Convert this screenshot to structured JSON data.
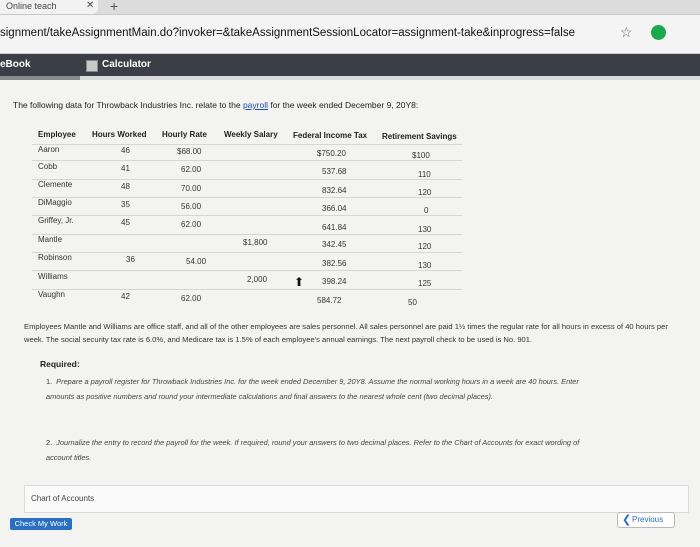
{
  "browser": {
    "tab_title": "Online teach",
    "close_glyph": "✕",
    "newtab_glyph": "+",
    "url": "signment/takeAssignmentMain.do?invoker=&takeAssignmentSessionLocator=assignment-take&inprogress=false",
    "star_glyph": "☆",
    "extension_glyph": "●"
  },
  "toolbar": {
    "ebook_label": "eBook",
    "calculator_label": "Calculator"
  },
  "problem": {
    "intro_before": "The following data for Throwback Industries Inc. relate to the ",
    "intro_link": "payroll",
    "intro_after": " for the week ended December 9, 20Y8:",
    "columns": [
      "Employee",
      "Hours Worked",
      "Hourly Rate",
      "Weekly Salary",
      "Federal Income Tax",
      "Retirement Savings"
    ],
    "rows": [
      {
        "employee": "Aaron",
        "hours": "46",
        "rate": "$68.00",
        "salary": "",
        "fit": "$750.20",
        "retire": "$100"
      },
      {
        "employee": "Cobb",
        "hours": "41",
        "rate": "62.00",
        "salary": "",
        "fit": "537.68",
        "retire": "110"
      },
      {
        "employee": "Clemente",
        "hours": "48",
        "rate": "70.00",
        "salary": "",
        "fit": "832.64",
        "retire": "120"
      },
      {
        "employee": "DiMaggio",
        "hours": "35",
        "rate": "56.00",
        "salary": "",
        "fit": "366.04",
        "retire": "0"
      },
      {
        "employee": "Griffey, Jr.",
        "hours": "45",
        "rate": "62.00",
        "salary": "",
        "fit": "641.84",
        "retire": "130"
      },
      {
        "employee": "Mantle",
        "hours": "",
        "rate": "",
        "salary": "$1,800",
        "fit": "342.45",
        "retire": "120"
      },
      {
        "employee": "Robinson",
        "hours": "36",
        "rate": "54.00",
        "salary": "",
        "fit": "382.56",
        "retire": "130"
      },
      {
        "employee": "Williams",
        "hours": "",
        "rate": "",
        "salary": "2,000",
        "fit": "398.24",
        "retire": "125"
      },
      {
        "employee": "Vaughn",
        "hours": "42",
        "rate": "62.00",
        "salary": "",
        "fit": "584.72",
        "retire": "50"
      }
    ],
    "cursor_glyph": "⬆",
    "paragraph": "Employees Mantle and Williams are office staff, and all of the other employees are sales personnel. All sales personnel are paid 1½ times the regular rate for all hours in excess of 40 hours per week. The social security tax rate is 6.0%, and Medicare tax is 1.5% of each employee's annual earnings. The next payroll check to be used is No. 901.",
    "required_title": "Required:",
    "requirements": [
      {
        "num": "1.",
        "text": "Prepare a payroll register for Throwback Industries Inc. for the week ended December 9, 20Y8. Assume the normal working hours in a week are 40 hours. Enter amounts as positive numbers and round your intermediate calculations and final answers to the nearest whole cent (two decimal places)."
      },
      {
        "num": "2.",
        "text": "Journalize the entry to record the payroll for the week. If required, round your answers to two decimal places. Refer to the Chart of Accounts for exact wording of account titles."
      }
    ]
  },
  "footer": {
    "chart_of_accounts_label": "Chart of Accounts",
    "check_label": "Check My Work",
    "previous_label": "Previous",
    "previous_chevron": "❮"
  }
}
